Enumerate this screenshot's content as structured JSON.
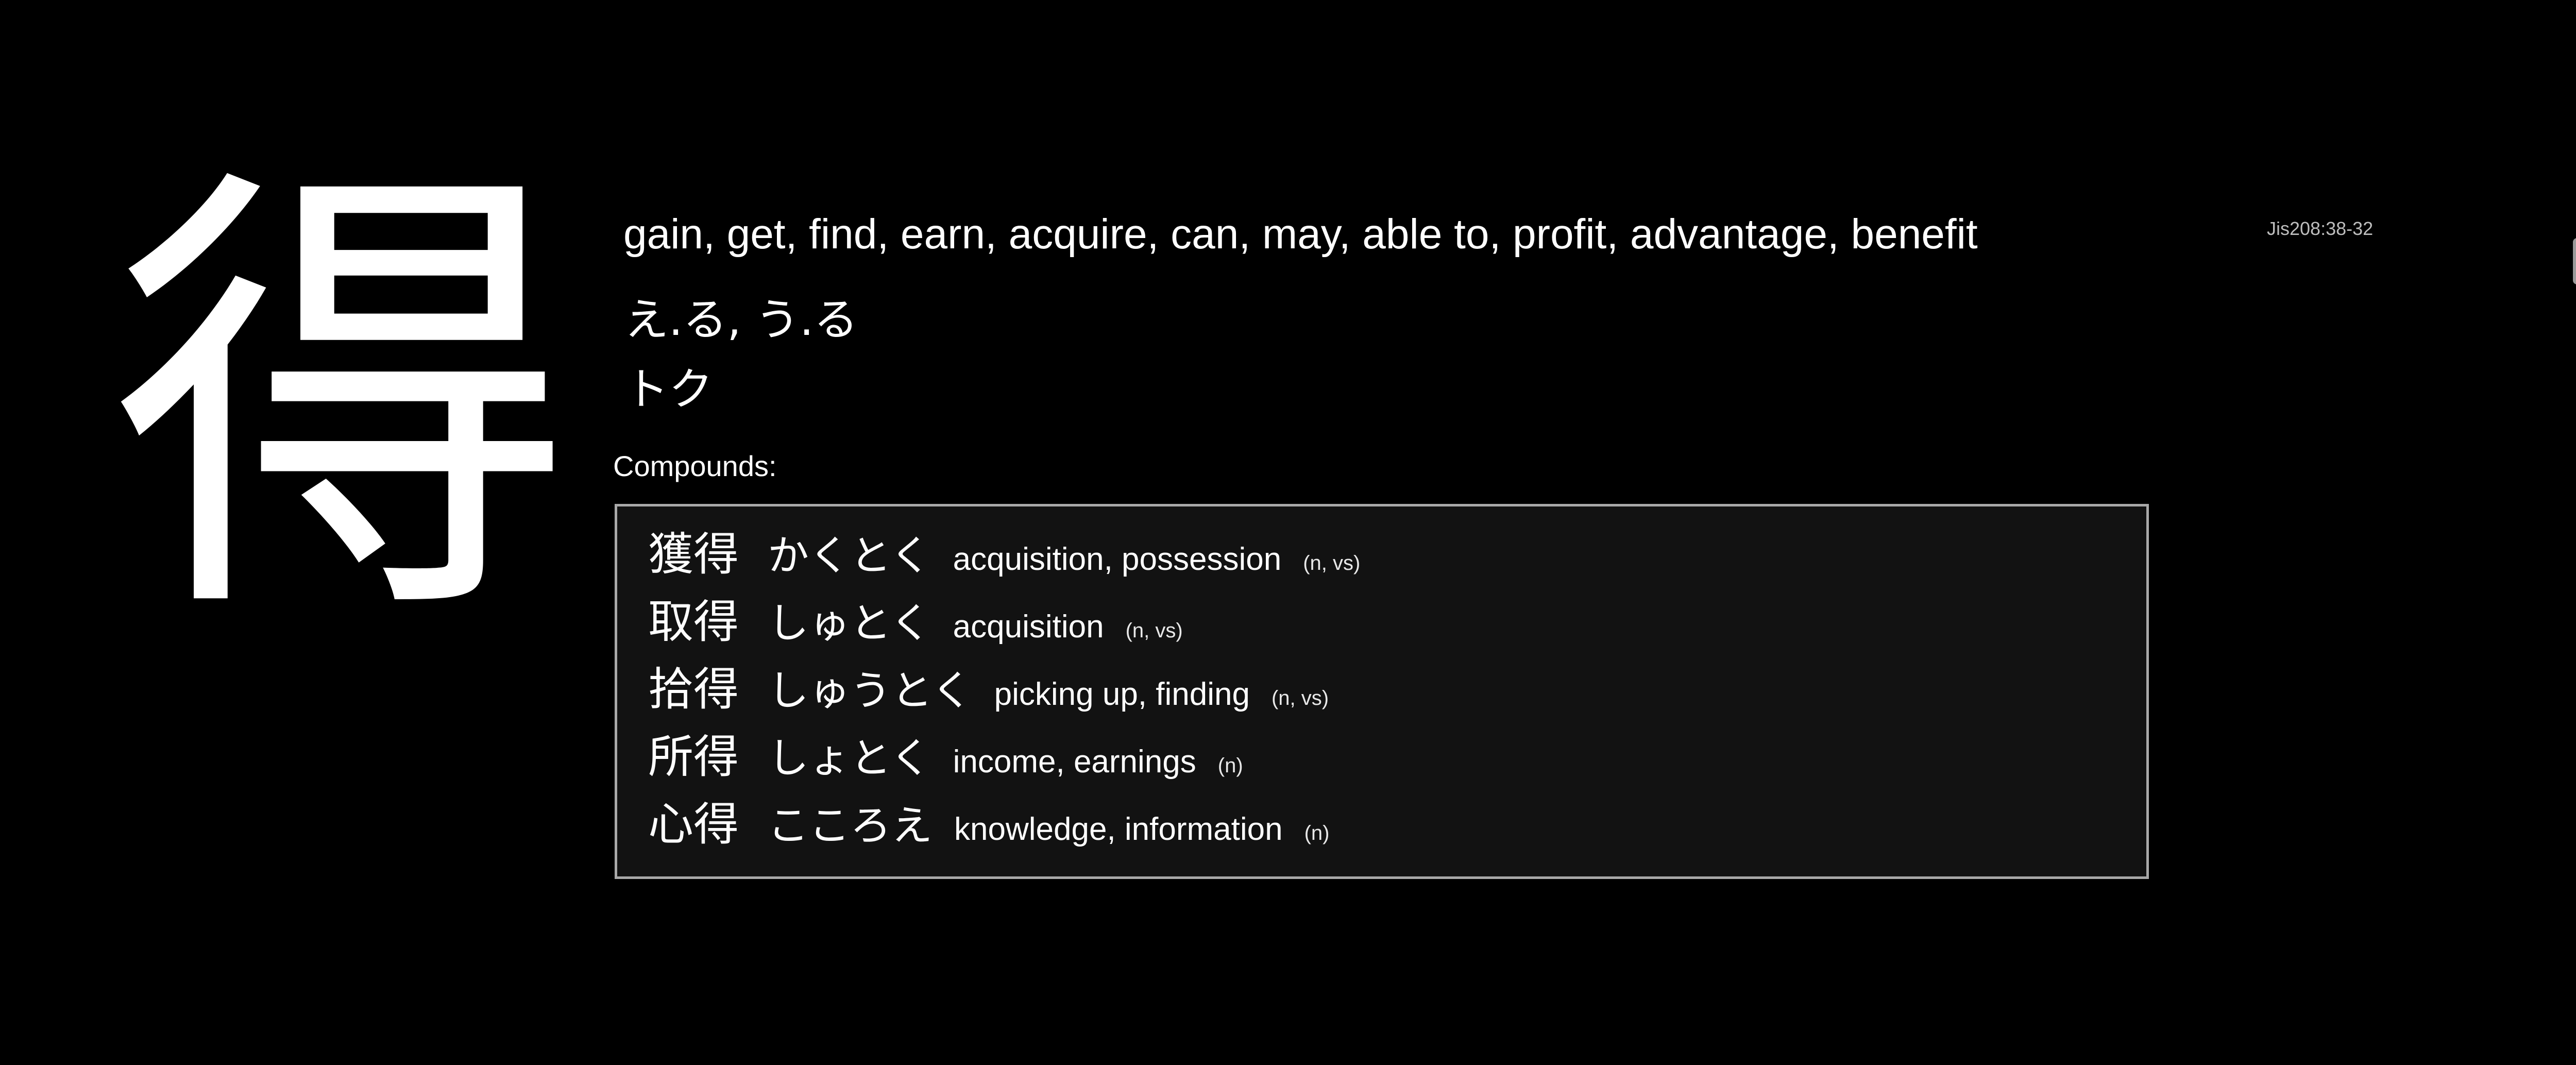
{
  "kanji": "得",
  "jis_code": "Jis208:38-32",
  "meanings": "gain, get, find, earn, acquire, can, may, able to, profit, advantage, benefit",
  "kun_reading": "え.る, う.る",
  "on_reading": "トク",
  "compounds_label": "Compounds:",
  "compounds": [
    {
      "kanji": "獲得",
      "kana": "かくとく",
      "meaning": "acquisition, possession",
      "pos": "(n, vs)"
    },
    {
      "kanji": "取得",
      "kana": "しゅとく",
      "meaning": "acquisition",
      "pos": "(n, vs)"
    },
    {
      "kanji": "拾得",
      "kana": "しゅうとく",
      "meaning": "picking up, finding",
      "pos": "(n, vs)"
    },
    {
      "kanji": "所得",
      "kana": "しょとく",
      "meaning": "income, earnings",
      "pos": "(n)"
    },
    {
      "kanji": "心得",
      "kana": "こころえ",
      "meaning": "knowledge, information",
      "pos": "(n)"
    }
  ]
}
